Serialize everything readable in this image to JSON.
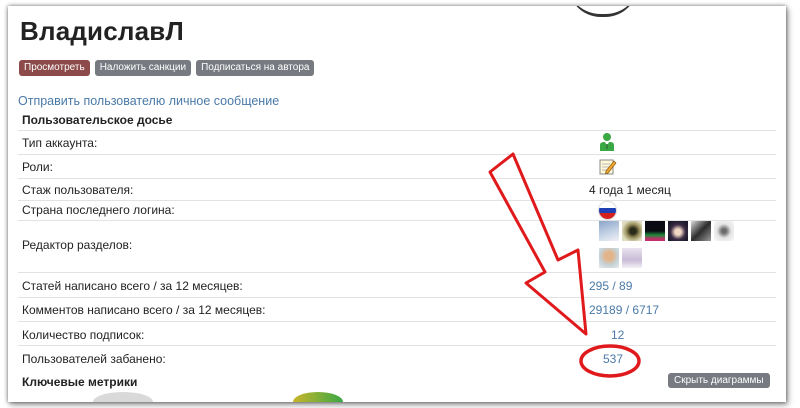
{
  "profile": {
    "username": "ВладиславЛ",
    "buttons": {
      "view": "Просмотреть",
      "sanctions": "Наложить санкции",
      "subscribe": "Подписаться на автора"
    },
    "pm_link": "Отправить пользователю личное сообщение"
  },
  "dossier": {
    "title": "Пользовательское досье",
    "account_type_label": "Тип аккаунта:",
    "roles_label": "Роли:",
    "tenure_label": "Стаж пользователя:",
    "tenure_value": "4 года 1 месяц",
    "country_label": "Страна последнего логина:",
    "editor_label": "Редактор разделов:",
    "articles_label": "Статей написано всего / за 12 месяцев:",
    "articles_value": "295 / 89",
    "comments_label": "Комментов написано всего / за 12 месяцев:",
    "comments_value": "29189 / 6717",
    "subscriptions_label": "Количество подписок:",
    "subscriptions_value": "12",
    "banned_label": "Пользователей забанено:",
    "banned_value": "537"
  },
  "metrics": {
    "title": "Ключевые метрики",
    "hide_button": "Скрыть диаграммы"
  },
  "icons": {
    "account_type": "user-green-icon",
    "roles": "notepad-pencil-icon",
    "country": "russia-flag-icon",
    "section_thumbs": [
      "section-thumb-1",
      "section-thumb-2",
      "section-thumb-3",
      "section-thumb-4",
      "section-thumb-5",
      "section-thumb-6",
      "section-thumb-7",
      "section-thumb-8"
    ]
  },
  "colors": {
    "link": "#4a79a8",
    "primary_button": "#8c4a4a",
    "secondary_button": "#777a80",
    "annotation": "#e0191c"
  }
}
